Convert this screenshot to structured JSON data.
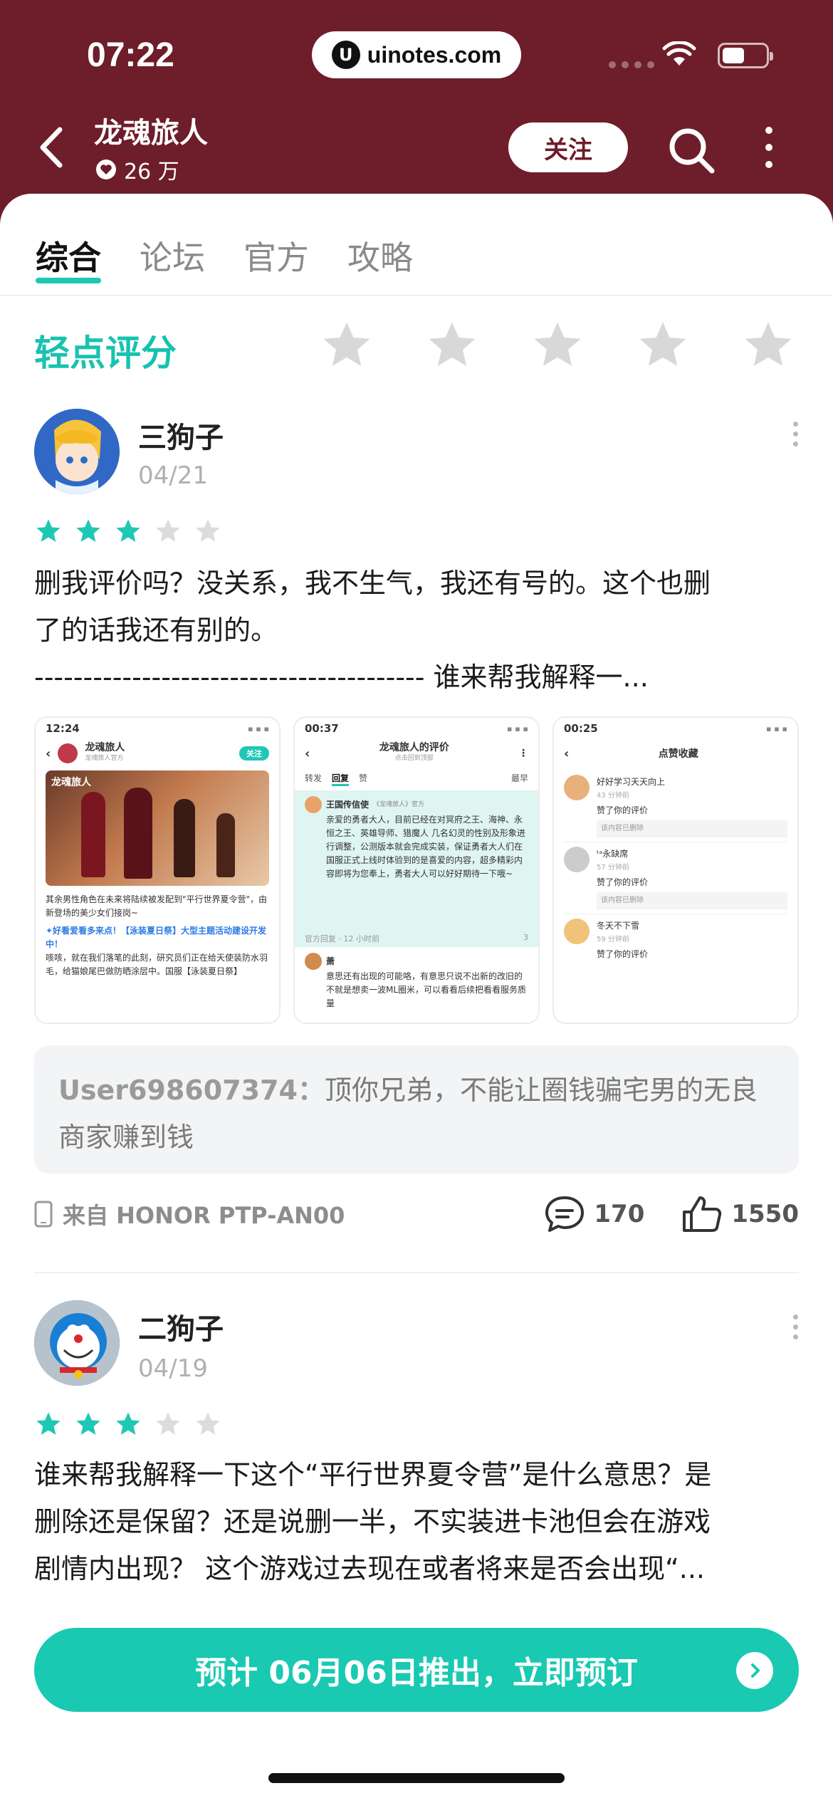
{
  "status_bar": {
    "time": "07:22",
    "url": "uinotes.com",
    "url_logo": "U"
  },
  "header": {
    "title": "龙魂旅人",
    "followers": "26 万",
    "follow_label": "关注"
  },
  "tabs": [
    {
      "label": "综合",
      "active": true
    },
    {
      "label": "论坛",
      "active": false
    },
    {
      "label": "官方",
      "active": false
    },
    {
      "label": "攻略",
      "active": false
    }
  ],
  "rating": {
    "label": "轻点评分",
    "stars": 5
  },
  "reviews": [
    {
      "user": "三狗子",
      "date": "04/21",
      "stars": 3,
      "lines": [
        "删我评价吗？没关系，我不生气，我还有号的。这个也删",
        "了的话我还有别的。",
        "---------------------------------------- 谁来帮我解释一..."
      ],
      "screenshots": [
        {
          "time": "12:24",
          "nav_title": "龙魂旅人",
          "nav_subtitle": "龙魂旅人官方",
          "follow": "关注",
          "banner": "龙魂旅人",
          "text1": "其余男性角色在未来将陆续被发配到\"平行世界夏令营\"，由新登场的美少女们接岗~",
          "text2": "✦好看爱看多来点！【泳装夏日祭】大型主题活动建设开发中！",
          "text3": "咳咳，就在我们落笔的此刻，研究员们正在给天使装防水羽毛，给猫娘尾巴做防晒涂层中。国服【泳装夏日祭】"
        },
        {
          "time": "00:37",
          "nav_title": "龙魂旅人的评价",
          "nav_subtitle": "点击回到顶部",
          "tab1": "转发",
          "tab2": "回复",
          "tab3": "赞",
          "sort": "最早",
          "author": "王国传信使",
          "author_sub": "《龙魂旅人》官方",
          "body": "亲爱的勇者大人，目前已经在对冥府之王、海神、永恒之王、英雄导师、猎魔人 几名幻灵的性别及形象进行调整，公测版本就会完成实装，保证勇者大人们在国服正式上线时体验到的是喜爱的内容，超多精彩内容即将为您奉上，勇者大人可以好好期待一下哦~",
          "meta": "官方回复 · 12 小时前",
          "reply": "回复",
          "like": "3",
          "user2": "萧",
          "body2": "意思还有出现的可能咯，有意思只说不出新的改旧的不就是想卖一波ML圈米，可以看看后续把看看服务质量"
        },
        {
          "time": "00:25",
          "nav_title": "点赞收藏",
          "items": [
            {
              "name": "好好学习天天向上",
              "ago": "43 分钟前",
              "action": "赞了你的评价",
              "quote": "该内容已删除"
            },
            {
              "name": "ᵗᵃ永缺席",
              "ago": "57 分钟前",
              "action": "赞了你的评价",
              "quote": "该内容已删除"
            },
            {
              "name": "冬天不下雪",
              "ago": "59 分钟前",
              "action": "赞了你的评价",
              "quote": ""
            }
          ]
        }
      ],
      "reply": {
        "user": "User698607374：",
        "text": "顶你兄弟，不能让圈钱骗宅男的无良商家赚到钱"
      },
      "device": "来自 HONOR PTP-AN00",
      "comments": "170",
      "likes": "1550"
    },
    {
      "user": "二狗子",
      "date": "04/19",
      "stars": 3,
      "lines": [
        "谁来帮我解释一下这个“平行世界夏令营”是什么意思？是",
        "删除还是保留？还是说删一半，不实装进卡池但会在游戏",
        "剧情内出现？ 这个游戏过去现在或者将来是否会出现“..."
      ]
    }
  ],
  "cta": {
    "label": "预计 06月06日推出，立即预订"
  },
  "colors": {
    "brand": "#6e1d2a",
    "accent": "#19c9b2",
    "star_on": "#1ec8b4",
    "star_off": "#d8d8d8"
  }
}
